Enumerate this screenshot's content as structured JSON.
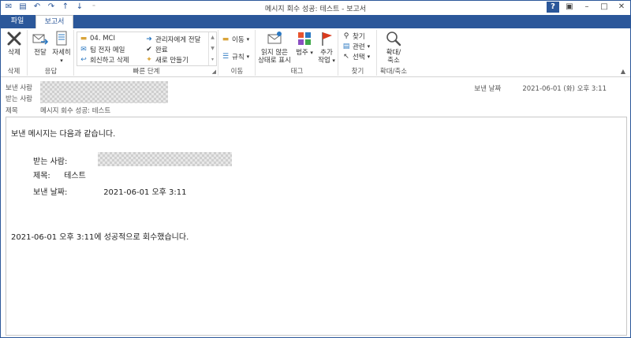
{
  "window": {
    "title": "메시지 회수 성공: 테스트 - 보고서"
  },
  "tabs": {
    "file": "파일",
    "report": "보고서"
  },
  "ribbon": {
    "delete_group": {
      "button": "삭제",
      "label": "삭제"
    },
    "respond_group": {
      "forward": "전달",
      "detail_line1": "자세히",
      "label": "응답"
    },
    "quicksteps": {
      "items": [
        "04. MCI",
        "관리자에게 전달",
        "팀 전자 메일",
        "완료",
        "회신하고 삭제",
        "새로 만들기"
      ],
      "label": "빠른 단계"
    },
    "move_group": {
      "move": "이동",
      "rules": "규칙",
      "label": "이동"
    },
    "tags_group": {
      "unread_line1": "읽지 않은",
      "unread_line2": "상태로 표시",
      "categorize": "범주",
      "followup_line1": "추가",
      "followup_line2": "작업",
      "label": "태그"
    },
    "find_group": {
      "find": "찾기",
      "related": "관련",
      "select": "선택",
      "label": "찾기"
    },
    "zoom_group": {
      "zoom_line1": "확대/",
      "zoom_line2": "축소",
      "label": "확대/축소"
    }
  },
  "header": {
    "from_label": "보낸 사람",
    "to_label": "받는 사람",
    "subject_label": "제목",
    "subject_value": "메시지 회수 성공: 테스트",
    "sent_label": "보낸 날짜",
    "sent_value": "2021-06-01 (화) 오후 3:11"
  },
  "body": {
    "intro": "보낸 메시지는 다음과 같습니다.",
    "to_label": "받는 사람:",
    "subject_label": "제목:",
    "subject_value": "테스트",
    "sent_label": "보낸 날짜:",
    "sent_value": "2021-06-01 오후 3:11",
    "final": "2021-06-01 오후 3:11에 성공적으로 회수했습니다."
  }
}
